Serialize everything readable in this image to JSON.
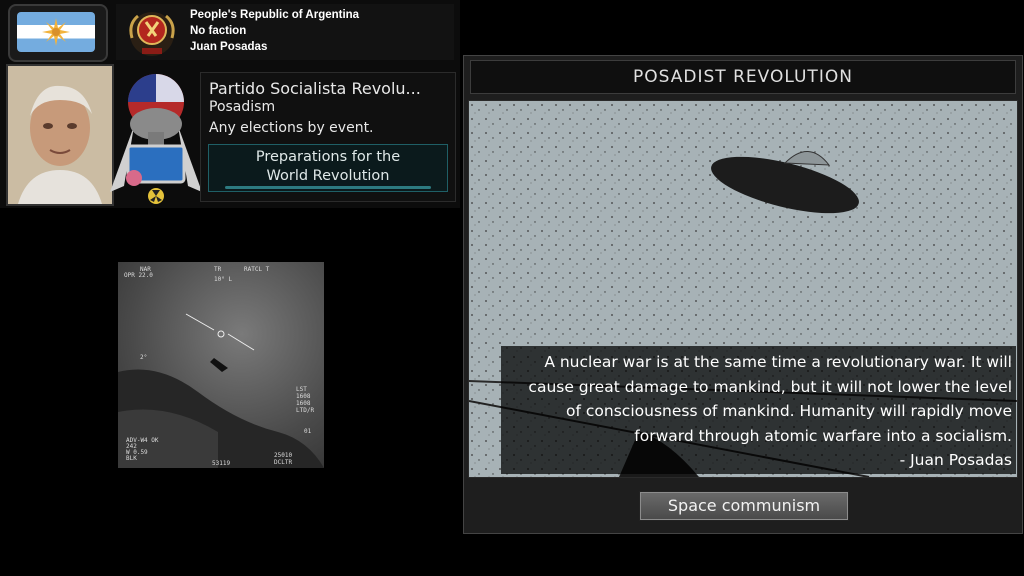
{
  "country": {
    "name": "People's Republic of Argentina",
    "faction": "No faction",
    "leader": "Juan Posadas"
  },
  "party": {
    "name": "Partido Socialista Revolu...",
    "ideology": "Posadism",
    "elections": "Any elections by event."
  },
  "ideology_button": {
    "label_line1": "Preparations for the",
    "label_line2": "World Revolution"
  },
  "ufo_hud": {
    "top_left": "NAR",
    "row2": "OPR 22.0",
    "top_mid": "TR",
    "top_right": "RATCL T",
    "mid_mark": "10° L",
    "left_mark": "2°",
    "right_block": "LST\n1608\n1608\nLTD/R",
    "right_01": "01",
    "bottom_left": "ADV-W4 OK\n242\nW 0.59\nBLK",
    "bottom_mid": "53119",
    "bottom_right": "25010\nDCLTR"
  },
  "event": {
    "title": "POSADIST REVOLUTION",
    "quote": "A nuclear war is at the same time a revolutionary war. It will\ncause great damage to mankind, but it will not lower the level\nof consciousness of mankind. Humanity will rapidly move\nforward through atomic warfare into a socialism.\n- Juan Posadas",
    "option": "Space communism"
  },
  "colors": {
    "accent_teal": "#2d7a80",
    "flag_blue": "#74acdf",
    "sun_gold": "#f2b33d"
  }
}
